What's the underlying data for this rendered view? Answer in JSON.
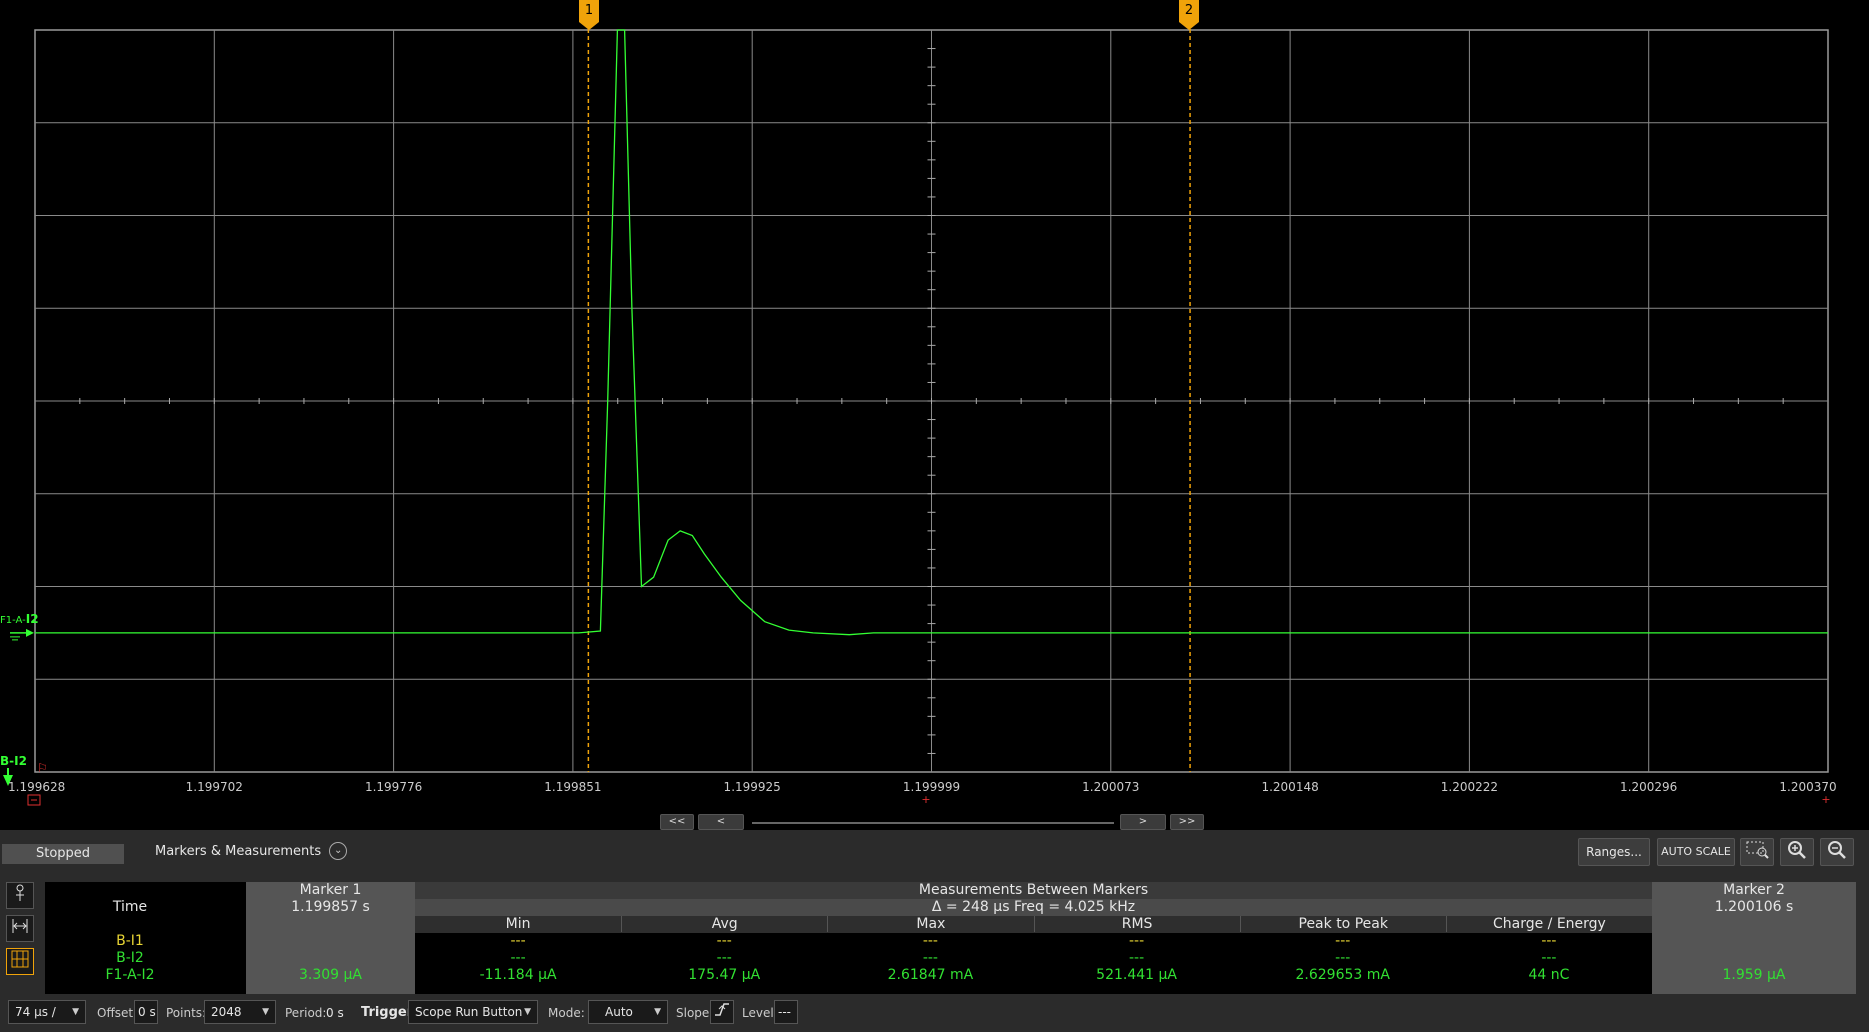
{
  "scope": {
    "x_tick_labels": [
      "1.199628",
      "1.199702",
      "1.199776",
      "1.199851",
      "1.199925",
      "1.199999",
      "1.200073",
      "1.200148",
      "1.200222",
      "1.200296",
      "1.200370"
    ],
    "trace_label_prefix": "F1-A-",
    "trace_label_main": "I2",
    "bottom_trace_label": "B-I2",
    "marker1_label": "1",
    "marker2_label": "2",
    "trace_color": "#33ff33",
    "marker_color": "#f0a30a"
  },
  "chart_data": {
    "type": "line",
    "title": "",
    "xlabel": "",
    "ylabel": "",
    "x_unit": "s",
    "xlim": [
      1.199628,
      1.20037
    ],
    "ylim_divisions": [
      -1.5,
      6.5
    ],
    "grid": true,
    "series": [
      {
        "name": "F1-A-I2",
        "points": [
          {
            "x": 1.199628,
            "y": 0
          },
          {
            "x": 1.199853,
            "y": 0
          },
          {
            "x": 1.199862,
            "y": 0.02
          },
          {
            "x": 1.199865,
            "y": 2.5
          },
          {
            "x": 1.199869,
            "y": 6.5
          },
          {
            "x": 1.199872,
            "y": 6.5
          },
          {
            "x": 1.199875,
            "y": 3.5
          },
          {
            "x": 1.199879,
            "y": 0.5
          },
          {
            "x": 1.199884,
            "y": 0.6
          },
          {
            "x": 1.19989,
            "y": 1.0
          },
          {
            "x": 1.199895,
            "y": 1.1
          },
          {
            "x": 1.1999,
            "y": 1.05
          },
          {
            "x": 1.199905,
            "y": 0.85
          },
          {
            "x": 1.199912,
            "y": 0.6
          },
          {
            "x": 1.19992,
            "y": 0.35
          },
          {
            "x": 1.19993,
            "y": 0.12
          },
          {
            "x": 1.19994,
            "y": 0.03
          },
          {
            "x": 1.19995,
            "y": 0.0
          },
          {
            "x": 1.199965,
            "y": -0.02
          },
          {
            "x": 1.199975,
            "y": 0.0
          },
          {
            "x": 1.19999,
            "y": 0.0
          },
          {
            "x": 1.199999,
            "y": 0.0
          },
          {
            "x": 1.20037,
            "y": 0.0
          }
        ]
      }
    ],
    "markers": [
      {
        "label": "1",
        "x": 1.199857
      },
      {
        "label": "2",
        "x": 1.200106
      }
    ]
  },
  "nav": {
    "first": "<<",
    "prev": "<",
    "next": ">",
    "last": ">>"
  },
  "panel": {
    "status": "Stopped",
    "markers_measurements": "Markers & Measurements",
    "ranges": "Ranges...",
    "auto_scale": "AUTO SCALE"
  },
  "table": {
    "time_label": "Time",
    "marker1_title": "Marker 1",
    "marker1_time": "1.199857 s",
    "between_title": "Measurements Between Markers",
    "between_sub": "Δ = 248 μs   Freq = 4.025 kHz",
    "marker2_title": "Marker 2",
    "marker2_time": "1.200106 s",
    "columns": [
      "Min",
      "Avg",
      "Max",
      "RMS",
      "Peak to Peak",
      "Charge / Energy"
    ],
    "rows": [
      {
        "name": "B-I1",
        "m1": "",
        "values": [
          "---",
          "---",
          "---",
          "---",
          "---",
          "---"
        ],
        "m2": ""
      },
      {
        "name": "B-I2",
        "m1": "",
        "values": [
          "---",
          "---",
          "---",
          "---",
          "---",
          "---"
        ],
        "m2": ""
      },
      {
        "name": "F1-A-I2",
        "m1": "3.309 μA",
        "values": [
          "-11.184 μA",
          "175.47 μA",
          "2.61847 mA",
          "521.441 μA",
          "2.629653 mA",
          "44 nC"
        ],
        "m2": "1.959 μA"
      }
    ]
  },
  "bottom": {
    "timebase": "74 μs /",
    "offset_label": "Offset:",
    "offset_value": "0 s",
    "points_label": "Points:",
    "points_value": "2048",
    "period_label": "Period:",
    "period_value": "0 s",
    "trigger_label": "Trigger",
    "trigger_value": "Scope Run Button",
    "mode_label": "Mode:",
    "mode_value": "Auto",
    "slope_label": "Slope:",
    "level_label": "Level:",
    "level_value": "---"
  }
}
